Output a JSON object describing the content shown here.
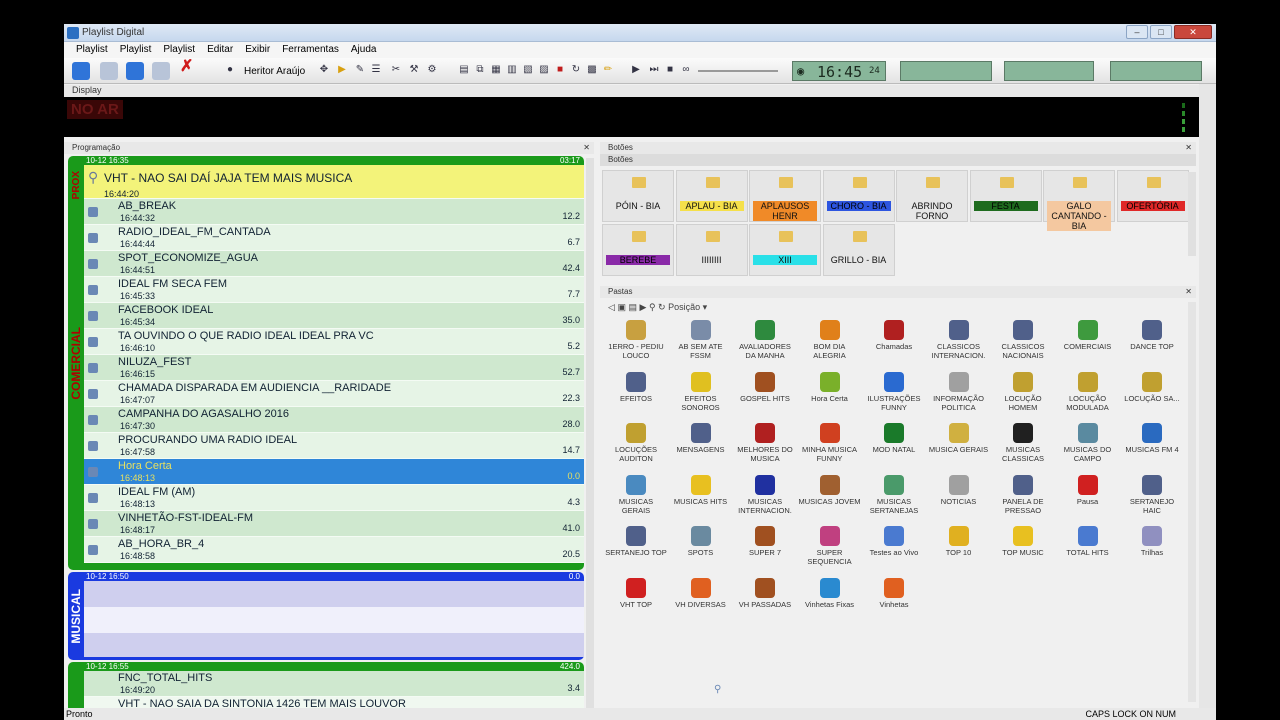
{
  "window": {
    "title": "Playlist Digital"
  },
  "menu": [
    "Playlist",
    "Playlist",
    "Playlist",
    "Editar",
    "Exibir",
    "Ferramentas",
    "Ajuda"
  ],
  "toolbar": {
    "user": "Heritor Araújo",
    "clock": "16:45",
    "clock_suffix": "24"
  },
  "display": {
    "label": "Display",
    "status": "NO AR"
  },
  "programacao": {
    "title": "Programação",
    "prox_block": {
      "side": "PROX",
      "header_date": "10-12 16:35",
      "header_dur": "03:17",
      "item": "VHT - NAO SAI DAÍ JAJA TEM MAIS MUSICA",
      "time": "16:44:20"
    },
    "comercial_block": {
      "side": "COMERCIAL",
      "rows": [
        {
          "name": "AB_BREAK",
          "time": "16:44:32",
          "dur": "12.2"
        },
        {
          "name": "RADIO_IDEAL_FM_CANTADA",
          "time": "16:44:44",
          "dur": "6.7"
        },
        {
          "name": "SPOT_ECONOMIZE_AGUA",
          "time": "16:44:51",
          "dur": "42.4"
        },
        {
          "name": "IDEAL FM SECA FEM",
          "time": "16:45:33",
          "dur": "7.7"
        },
        {
          "name": "FACEBOOK IDEAL",
          "time": "16:45:34",
          "dur": "35.0"
        },
        {
          "name": "TA OUVINDO O QUE RADIO IDEAL IDEAL PRA VC",
          "time": "16:46:10",
          "dur": "5.2"
        },
        {
          "name": "NILUZA_FEST",
          "time": "16:46:15",
          "dur": "52.7"
        },
        {
          "name": "CHAMADA DISPARADA EM AUDIENCIA __RARIDADE",
          "time": "16:47:07",
          "dur": "22.3"
        },
        {
          "name": "CAMPANHA DO AGASALHO 2016",
          "time": "16:47:30",
          "dur": "28.0"
        },
        {
          "name": "PROCURANDO UMA RADIO IDEAL",
          "time": "16:47:58",
          "dur": "14.7"
        },
        {
          "name": "Hora Certa",
          "time": "16:48:13",
          "dur": "0.0"
        },
        {
          "name": "IDEAL FM (AM)",
          "time": "16:48:13",
          "dur": "4.3"
        },
        {
          "name": "VINHETÃO-FST-IDEAL-FM",
          "time": "16:48:17",
          "dur": "41.0"
        },
        {
          "name": "AB_HORA_BR_4",
          "time": "16:48:58",
          "dur": "20.5"
        }
      ]
    },
    "musical_block": {
      "side": "MUSICAL",
      "header_date": "10-12 16:50",
      "header_dur": "0.0"
    },
    "next_block": {
      "header_date": "10-12 16:55",
      "header_dur": "424.0",
      "rows": [
        {
          "name": "FNC_TOTAL_HITS",
          "time": "16:49:20",
          "dur": "3.4"
        },
        {
          "name": "VHT - NAO SAIA DA SINTONIA 1426 TEM MAIS LOUVOR",
          "time": "",
          "dur": ""
        }
      ]
    }
  },
  "botoes": {
    "title": "Botões",
    "subtitle": "Botões",
    "buttons": [
      {
        "label": "PÓIN - BIA",
        "color": "#e6e6e6"
      },
      {
        "label": "APLAU - BIA",
        "color": "#f5e04a"
      },
      {
        "label": "APLAUSOS HENR",
        "color": "#f08a28"
      },
      {
        "label": "CHORO - BIA",
        "color": "#2d55e0"
      },
      {
        "label": "ABRINDO FORNO",
        "color": "#e6e6e6"
      },
      {
        "label": "FESTA",
        "color": "#1e6b1e"
      },
      {
        "label": "GALO CANTANDO - BIA",
        "color": "#f4c8a0"
      },
      {
        "label": "OFERTÓRIA",
        "color": "#e02828"
      },
      {
        "label": "BEREBE",
        "color": "#8a2aa8"
      },
      {
        "label": "IIIIIIII",
        "color": "#e6e6e6"
      },
      {
        "label": "XIII",
        "color": "#29e0e8"
      },
      {
        "label": "GRILLO - BIA",
        "color": "#e6e6e6"
      }
    ]
  },
  "pastas": {
    "title": "Pastas",
    "position_label": "Posição",
    "items": [
      {
        "label": "1ERRO - PEDIU LOUCO",
        "icon": "gear-icon",
        "color": "#c8a040"
      },
      {
        "label": "AB SEM ATE FSSM",
        "icon": "search-icon",
        "color": "#7a8ca8"
      },
      {
        "label": "AVALIADORES DA MANHA",
        "icon": "globe-icon",
        "color": "#2e8a3e"
      },
      {
        "label": "BOM DIA ALEGRIA",
        "icon": "smiley-icon",
        "color": "#e0801a"
      },
      {
        "label": "Chamadas",
        "icon": "car-icon",
        "color": "#b02020"
      },
      {
        "label": "CLASSICOS INTERNACION.",
        "icon": "music-icon",
        "color": "#50608a"
      },
      {
        "label": "CLASSICOS NACIONAIS",
        "icon": "music-icon",
        "color": "#50608a"
      },
      {
        "label": "COMERCIAIS",
        "icon": "user-icon",
        "color": "#3e9a3e"
      },
      {
        "label": "DANCE TOP",
        "icon": "music-icon",
        "color": "#50608a"
      },
      {
        "label": "EFEITOS",
        "icon": "music-icon",
        "color": "#50608a"
      },
      {
        "label": "EFEITOS SONOROS",
        "icon": "lightning-icon",
        "color": "#e0c020"
      },
      {
        "label": "GOSPEL HITS",
        "icon": "book-icon",
        "color": "#a05020"
      },
      {
        "label": "Hora Certa",
        "icon": "clock-icon",
        "color": "#7ab02a"
      },
      {
        "label": "ILUSTRAÇÕES FUNNY",
        "icon": "molecule-icon",
        "color": "#2a6ad0"
      },
      {
        "label": "INFORMAÇÃO POLITICA",
        "icon": "person-icon",
        "color": "#a0a0a0"
      },
      {
        "label": "LOCUÇÃO HOMEM",
        "icon": "speaker-icon",
        "color": "#c0a030"
      },
      {
        "label": "LOCUÇÃO MODULADA",
        "icon": "speaker-icon",
        "color": "#c0a030"
      },
      {
        "label": "LOCUÇÃO SA...",
        "icon": "speaker-icon",
        "color": "#c0a030"
      },
      {
        "label": "LOCUÇÕES AUDITON",
        "icon": "speaker-icon",
        "color": "#c0a030"
      },
      {
        "label": "MENSAGENS",
        "icon": "music-icon",
        "color": "#50608a"
      },
      {
        "label": "MELHORES DO MUSICA",
        "icon": "alarm-icon",
        "color": "#b02020"
      },
      {
        "label": "MINHA MUSICA FUNNY",
        "icon": "document-icon",
        "color": "#d04020"
      },
      {
        "label": "MOD NATAL",
        "icon": "tree-icon",
        "color": "#1a7a2a"
      },
      {
        "label": "MUSICA GERAIS",
        "icon": "cd-icon",
        "color": "#d0b040"
      },
      {
        "label": "MUSICAS CLASSICAS",
        "icon": "record-icon",
        "color": "#202020"
      },
      {
        "label": "MUSICAS DO CAMPO",
        "icon": "landscape-icon",
        "color": "#5a8aa0"
      },
      {
        "label": "MUSICAS FM 4",
        "icon": "globe-icon",
        "color": "#2a6ac0"
      },
      {
        "label": "MUSICAS GERAIS",
        "icon": "globe-icon",
        "color": "#4a8ac0"
      },
      {
        "label": "MUSICAS HITS",
        "icon": "star-icon",
        "color": "#e8c020"
      },
      {
        "label": "MUSICAS INTERNACION.",
        "icon": "flag-icon",
        "color": "#2030a0"
      },
      {
        "label": "MUSICAS JOVEM",
        "icon": "person-icon",
        "color": "#a06030"
      },
      {
        "label": "MUSICAS SERTANEJAS",
        "icon": "landscape-icon",
        "color": "#4a9a6a"
      },
      {
        "label": "NOTICIAS",
        "icon": "person-icon",
        "color": "#a0a0a0"
      },
      {
        "label": "PANELA DE PRESSAO",
        "icon": "music-icon",
        "color": "#50608a"
      },
      {
        "label": "Pausa",
        "icon": "pause-icon",
        "color": "#d02020"
      },
      {
        "label": "SERTANEJO HAIC",
        "icon": "music-icon",
        "color": "#50608a"
      },
      {
        "label": "SERTANEJO TOP",
        "icon": "music-icon",
        "color": "#50608a"
      },
      {
        "label": "SPOTS",
        "icon": "bell-icon",
        "color": "#6a8aa0"
      },
      {
        "label": "SUPER 7",
        "icon": "book-icon",
        "color": "#a05020"
      },
      {
        "label": "SUPER SEQUENCIA",
        "icon": "cube-icon",
        "color": "#c04080"
      },
      {
        "label": "Testes ao Vivo",
        "icon": "document-icon",
        "color": "#4a7ad0"
      },
      {
        "label": "TOP 10",
        "icon": "coin-icon",
        "color": "#e0b020"
      },
      {
        "label": "TOP MUSIC",
        "icon": "star-icon",
        "color": "#e8c020"
      },
      {
        "label": "TOTAL HITS",
        "icon": "document-icon",
        "color": "#4a7ad0"
      },
      {
        "label": "Trilhas",
        "icon": "cd-icon",
        "color": "#9090c0"
      },
      {
        "label": "VHT TOP",
        "icon": "close-icon",
        "color": "#d02020"
      },
      {
        "label": "VH DIVERSAS",
        "icon": "refresh-icon",
        "color": "#e06020"
      },
      {
        "label": "VH PASSADAS",
        "icon": "book-icon",
        "color": "#a05020"
      },
      {
        "label": "Vinhetas Fixas",
        "icon": "refresh-icon",
        "color": "#2a8ad0"
      },
      {
        "label": "Vinhetas",
        "icon": "refresh-icon",
        "color": "#e06020"
      }
    ]
  },
  "status": {
    "left": "Pronto",
    "right": "CAPS LOCK ON   NUM"
  }
}
